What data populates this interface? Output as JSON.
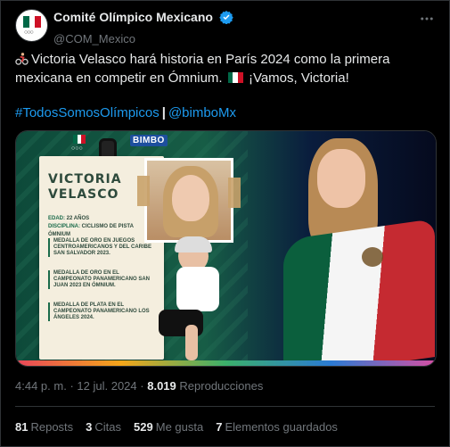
{
  "author": {
    "name": "Comité Olímpico Mexicano",
    "handle": "@COM_Mexico",
    "verified": true
  },
  "tweet": {
    "text_line1": "Victoria Velasco hará historia en París 2024 como la primera",
    "text_line2_a": "mexicana en competir en Ómnium.",
    "text_line2_b": "¡Vamos, Victoria!",
    "hashtag": "#TodosSomosOlímpicos",
    "separator": "|",
    "mention": "@bimboMx"
  },
  "media": {
    "athlete_first": "VICTORIA",
    "athlete_last": "VELASCO",
    "age_label": "EDAD:",
    "age_value": "22 AÑOS",
    "discipline_label": "DISCIPLINA:",
    "discipline_value": "CICLISMO DE PISTA ÓMNIUM",
    "medals": [
      "MEDALLA DE ORO EN JUEGOS CENTROAMERICANOS Y DEL CARIBE SAN SALVADOR 2023.",
      "MEDALLA DE ORO EN EL CAMPEONATO PANAMERICANO SAN JUAN 2023 EN ÓMNIUM.",
      "MEDALLA DE PLATA EN EL CAMPEONATO PANAMERICANO LOS ÁNGELES 2024."
    ],
    "sponsor": "BIMBO"
  },
  "meta": {
    "time": "4:44 p. m.",
    "dot": "·",
    "date": "12 jul. 2024",
    "views_count": "8.019",
    "views_label": "Reproducciones"
  },
  "stats": [
    {
      "count": "81",
      "label": "Reposts"
    },
    {
      "count": "3",
      "label": "Citas"
    },
    {
      "count": "529",
      "label": "Me gusta"
    },
    {
      "count": "7",
      "label": "Elementos guardados"
    }
  ],
  "icons": {
    "more": "more-icon",
    "verified": "verified-badge-icon",
    "cyclist": "cyclist-emoji-icon",
    "flag": "mexico-flag-emoji-icon"
  },
  "colors": {
    "background": "#000000",
    "text": "#e7e9ea",
    "muted": "#71767b",
    "link": "#1d9bf0",
    "divider": "#2f3336"
  }
}
